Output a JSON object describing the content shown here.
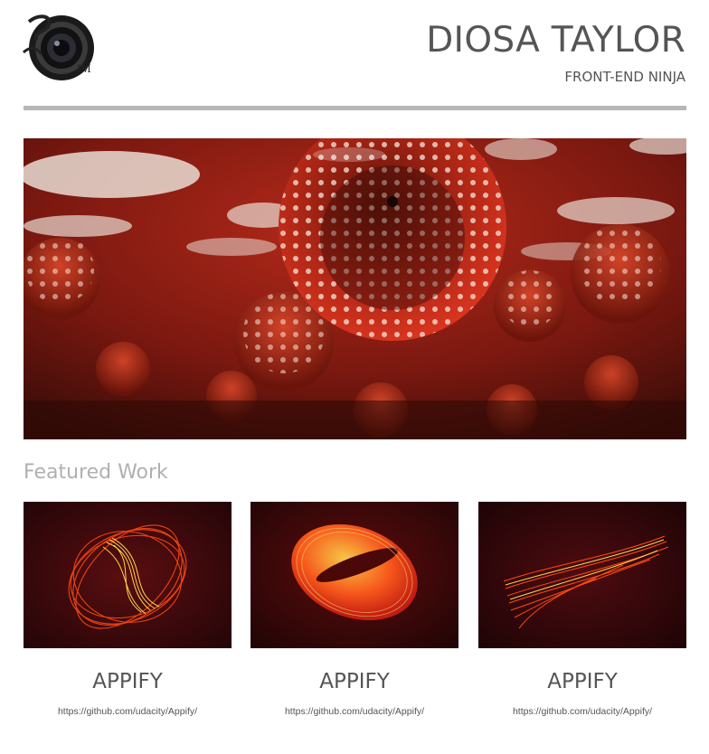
{
  "header": {
    "logo": {
      "icon": "camera-lens-logo",
      "text": "JM"
    },
    "title": "DIOSA TAYLOR",
    "subtitle": "FRONT-END NINJA"
  },
  "hero": {
    "description_icon": "polka-dot-mirror-spheres-image"
  },
  "featured": {
    "heading": "Featured Work",
    "projects": [
      {
        "name": "APPIFY",
        "url": "https://github.com/udacity/Appify/",
        "image": "light-spiral-orb"
      },
      {
        "name": "APPIFY",
        "url": "https://github.com/udacity/Appify/",
        "image": "light-ellipse-ring"
      },
      {
        "name": "APPIFY",
        "url": "https://github.com/udacity/Appify/",
        "image": "light-twisted-ribbon"
      }
    ]
  },
  "colors": {
    "divider": "#b7b7b7",
    "heading_muted": "#b0b0b0",
    "text": "#555555",
    "accent_red": "#c81e14"
  }
}
